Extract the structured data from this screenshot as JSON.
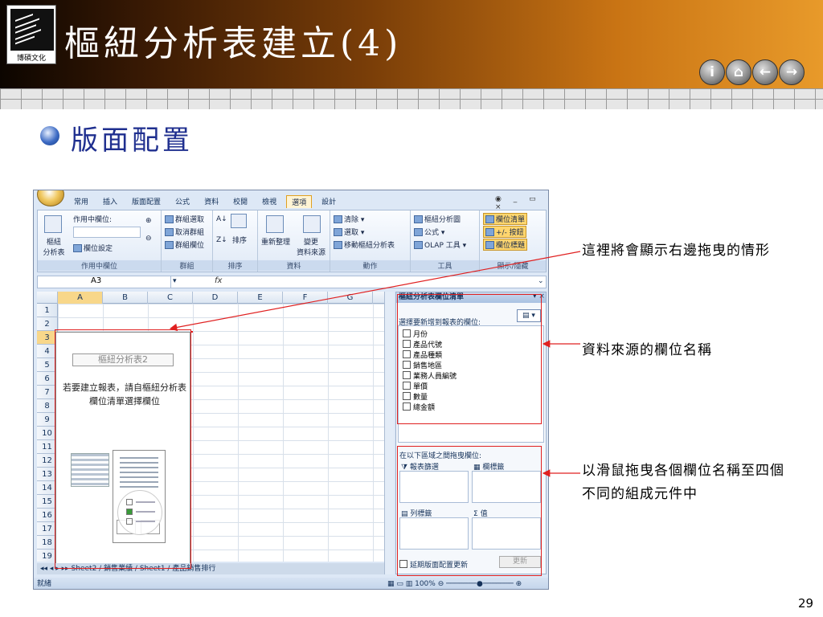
{
  "slide": {
    "logo_text": "博碩文化",
    "title": "樞紐分析表建立(4)",
    "bullet": "版面配置",
    "page_number": "29",
    "nav_buttons": [
      {
        "icon": "info-icon",
        "glyph": "i"
      },
      {
        "icon": "home-icon",
        "glyph": "⌂"
      },
      {
        "icon": "back-arrow-icon",
        "glyph": "←"
      },
      {
        "icon": "forward-arrow-icon",
        "glyph": "→"
      }
    ]
  },
  "annotations": {
    "note1": "這裡將會顯示右邊拖曳的情形",
    "note2": "資料來源的欄位名稱",
    "note3": "以滑鼠拖曳各個欄位名稱至四個不同的組成元件中"
  },
  "excel": {
    "tabs": [
      "常用",
      "插入",
      "版面配置",
      "公式",
      "資料",
      "校閱",
      "檢視",
      "選項",
      "設計"
    ],
    "active_tab": "選項",
    "window_controls": "◉ _ ▭ ×",
    "ribbon": {
      "active_field_label": "作用中欄位:",
      "pivot_label": "樞紐\n分析表",
      "field_settings": "欄位設定",
      "group_active_field": "作用中欄位",
      "group_selection": "群組選取",
      "ungroup": "取消群組",
      "group_field": "群組欄位",
      "group_group": "群組",
      "sort": "排序",
      "group_sort": "排序",
      "refresh": "重新整理",
      "change_source": "變更\n資料來源",
      "group_data": "資料",
      "clear": "清除",
      "select": "選取",
      "move_pivot": "移動樞紐分析表",
      "group_actions": "動作",
      "pivot_chart": "樞紐分析圖",
      "formulas": "公式",
      "olap_tools": "OLAP 工具",
      "group_tools": "工具",
      "field_list": "欄位清單",
      "plus_minus": "+/- 按鈕",
      "field_headers": "欄位標題",
      "group_show_hide": "顯示/隱藏"
    },
    "name_box": "A3",
    "fx": "fx",
    "columns": [
      "A",
      "B",
      "C",
      "D",
      "E",
      "F",
      "G"
    ],
    "rows": [
      "1",
      "2",
      "3",
      "4",
      "5",
      "6",
      "7",
      "8",
      "9",
      "10",
      "11",
      "12",
      "13",
      "14",
      "15",
      "16",
      "17",
      "18",
      "19"
    ],
    "pivot_name": "樞紐分析表2",
    "pivot_message": "若要建立報表，請自樞紐分析表欄位清單選擇欄位",
    "sheet_tabs": "Sheet2 / 銷售業績 / Sheet1 / 產品銷售排行",
    "status": "就緒",
    "zoom": "100%",
    "pane": {
      "title": "樞紐分析表欄位清單",
      "prompt": "選擇要新增到報表的欄位:",
      "fields": [
        "月份",
        "產品代號",
        "產品種類",
        "銷售地區",
        "業務人員編號",
        "單價",
        "數量",
        "總金額"
      ],
      "drag_prompt": "在以下區域之間拖曳欄位:",
      "zone_report_filter": "報表篩選",
      "zone_column_labels": "欄標籤",
      "zone_row_labels": "列標籤",
      "zone_values": "值",
      "defer_update": "延期版面配置更新",
      "update_button": "更新"
    }
  }
}
